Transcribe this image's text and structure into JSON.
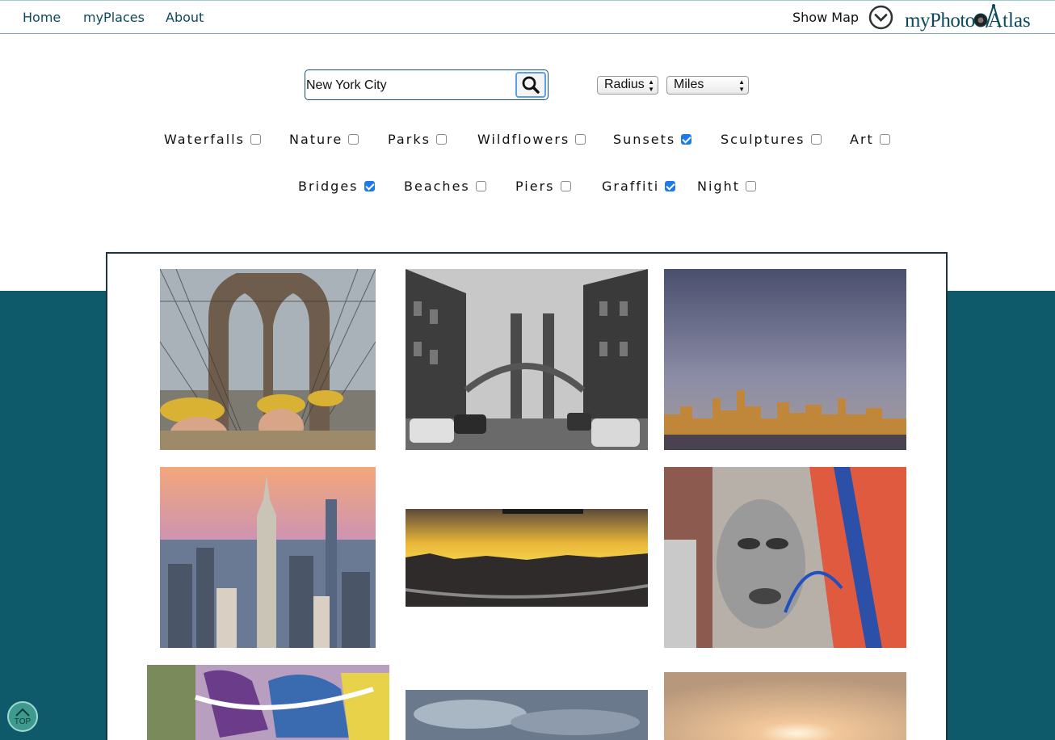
{
  "nav": {
    "home": "Home",
    "my_places": "myPlaces",
    "about": "About",
    "show_map": "Show Map",
    "logo_text": "myPhotoAtlas"
  },
  "search": {
    "value": "New York City",
    "icon": "search-icon"
  },
  "filters": {
    "radius": "Radius",
    "units": "Miles"
  },
  "categories": [
    {
      "label": "Waterfalls",
      "checked": false
    },
    {
      "label": "Nature",
      "checked": false
    },
    {
      "label": "Parks",
      "checked": false
    },
    {
      "label": "Wildflowers",
      "checked": false
    },
    {
      "label": "Sunsets",
      "checked": true
    },
    {
      "label": "Sculptures",
      "checked": false
    },
    {
      "label": "Art",
      "checked": false
    },
    {
      "label": "Bridges",
      "checked": true
    },
    {
      "label": "Beaches",
      "checked": false
    },
    {
      "label": "Piers",
      "checked": false
    },
    {
      "label": "Graffiti",
      "checked": true
    },
    {
      "label": "Night",
      "checked": false
    }
  ],
  "top_button": "TOP",
  "colors": {
    "brand_teal": "#0f5a6a",
    "checkbox_blue": "#1e7ae8",
    "link": "#0b4a5a"
  }
}
